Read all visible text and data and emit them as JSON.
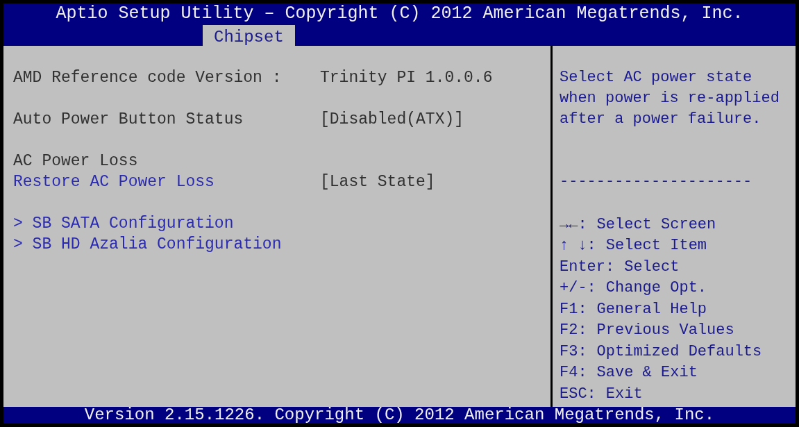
{
  "header": {
    "title": "Aptio Setup Utility – Copyright (C) 2012 American Megatrends, Inc."
  },
  "tabs": [
    {
      "label": "Chipset",
      "selected": true
    }
  ],
  "sections": [
    [
      {
        "kind": "info",
        "label": "AMD Reference code Version :",
        "value": "Trinity PI 1.0.0.6"
      }
    ],
    [
      {
        "kind": "setting",
        "label": "Auto Power Button Status",
        "value": "[Disabled(ATX)]",
        "selected": false
      }
    ],
    [
      {
        "kind": "heading",
        "label": "AC Power Loss"
      },
      {
        "kind": "setting",
        "label": "Restore AC Power Loss",
        "value": "[Last State]",
        "selected": true
      }
    ],
    [
      {
        "kind": "submenu",
        "marker": ">",
        "label": "SB SATA Configuration"
      },
      {
        "kind": "submenu",
        "marker": ">",
        "label": "SB HD Azalia Configuration"
      }
    ]
  ],
  "help": {
    "description": [
      "Select AC power state",
      "when power is re-applied",
      "after a power failure."
    ],
    "separator": "---------------------",
    "keys": [
      {
        "key": "→←:",
        "action": "Select Screen"
      },
      {
        "key": "↑ ↓:",
        "action": "Select Item"
      },
      {
        "key": "Enter:",
        "action": "Select"
      },
      {
        "key": "+/-:",
        "action": "Change Opt."
      },
      {
        "key": "F1:",
        "action": "General Help"
      },
      {
        "key": "F2:",
        "action": "Previous Values"
      },
      {
        "key": "F3:",
        "action": "Optimized Defaults"
      },
      {
        "key": "F4:",
        "action": "Save & Exit"
      },
      {
        "key": "ESC:",
        "action": "Exit"
      }
    ]
  },
  "footer": {
    "text": "Version 2.15.1226. Copyright (C) 2012 American Megatrends, Inc."
  }
}
